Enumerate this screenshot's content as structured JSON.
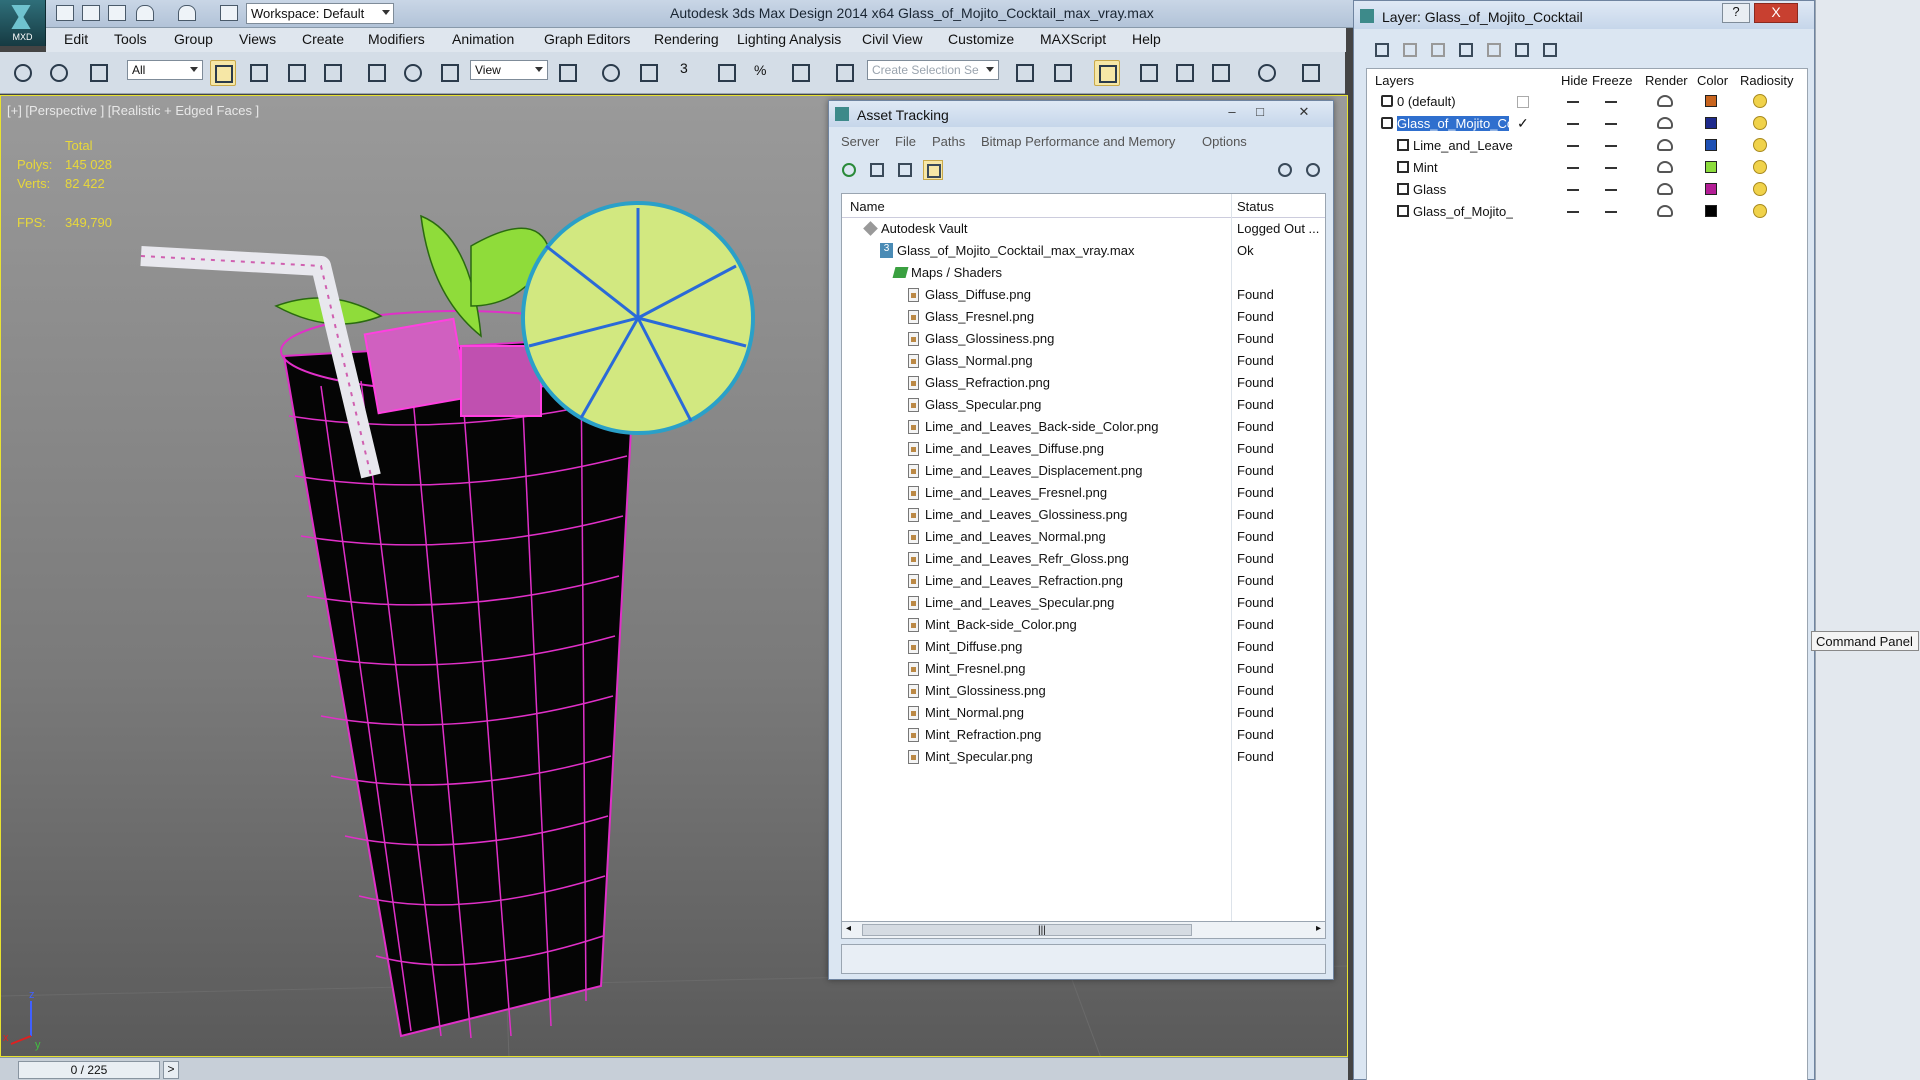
{
  "app": {
    "logo_label": "MXD",
    "title": "Autodesk 3ds Max Design 2014 x64    Glass_of_Mojito_Cocktail_max_vray.max",
    "workspace": "Workspace: Default"
  },
  "menu": [
    "Edit",
    "Tools",
    "Group",
    "Views",
    "Create",
    "Modifiers",
    "Animation",
    "Graph Editors",
    "Rendering",
    "Lighting Analysis",
    "Civil View",
    "Customize",
    "MAXScript",
    "Help"
  ],
  "toolbar": {
    "filter_value": "All",
    "ref_coord_value": "View",
    "selection_set_placeholder": "Create Selection Se",
    "snap_3_label": "3",
    "snap_percent_label": "%"
  },
  "viewport": {
    "label": "[+] [Perspective ] [Realistic + Edged Faces ]",
    "stats": {
      "total_label": "Total",
      "polys_label": "Polys:",
      "polys_value": "145 028",
      "verts_label": "Verts:",
      "verts_value": "82 422",
      "fps_label": "FPS:",
      "fps_value": "349,790"
    },
    "axis_z": "z",
    "axis_y": "y",
    "axis_x": "x"
  },
  "timeline": {
    "frame": "0 / 225",
    "next": ">"
  },
  "asset_tracking": {
    "title": "Asset Tracking",
    "menu": [
      "Server",
      "File",
      "Paths",
      "Bitmap Performance and Memory",
      "Options"
    ],
    "columns": {
      "name": "Name",
      "status": "Status"
    },
    "rows": [
      {
        "name": "Autodesk Vault",
        "status": "Logged Out ...",
        "kind": "vault",
        "indent": 0
      },
      {
        "name": "Glass_of_Mojito_Cocktail_max_vray.max",
        "status": "Ok",
        "kind": "max",
        "indent": 1
      },
      {
        "name": "Maps / Shaders",
        "status": "",
        "kind": "maps",
        "indent": 2
      },
      {
        "name": "Glass_Diffuse.png",
        "status": "Found",
        "kind": "file",
        "indent": 3
      },
      {
        "name": "Glass_Fresnel.png",
        "status": "Found",
        "kind": "file",
        "indent": 3
      },
      {
        "name": "Glass_Glossiness.png",
        "status": "Found",
        "kind": "file",
        "indent": 3
      },
      {
        "name": "Glass_Normal.png",
        "status": "Found",
        "kind": "file",
        "indent": 3
      },
      {
        "name": "Glass_Refraction.png",
        "status": "Found",
        "kind": "file",
        "indent": 3
      },
      {
        "name": "Glass_Specular.png",
        "status": "Found",
        "kind": "file",
        "indent": 3
      },
      {
        "name": "Lime_and_Leaves_Back-side_Color.png",
        "status": "Found",
        "kind": "file",
        "indent": 3
      },
      {
        "name": "Lime_and_Leaves_Diffuse.png",
        "status": "Found",
        "kind": "file",
        "indent": 3
      },
      {
        "name": "Lime_and_Leaves_Displacement.png",
        "status": "Found",
        "kind": "file",
        "indent": 3
      },
      {
        "name": "Lime_and_Leaves_Fresnel.png",
        "status": "Found",
        "kind": "file",
        "indent": 3
      },
      {
        "name": "Lime_and_Leaves_Glossiness.png",
        "status": "Found",
        "kind": "file",
        "indent": 3
      },
      {
        "name": "Lime_and_Leaves_Normal.png",
        "status": "Found",
        "kind": "file",
        "indent": 3
      },
      {
        "name": "Lime_and_Leaves_Refr_Gloss.png",
        "status": "Found",
        "kind": "file",
        "indent": 3
      },
      {
        "name": "Lime_and_Leaves_Refraction.png",
        "status": "Found",
        "kind": "file",
        "indent": 3
      },
      {
        "name": "Lime_and_Leaves_Specular.png",
        "status": "Found",
        "kind": "file",
        "indent": 3
      },
      {
        "name": "Mint_Back-side_Color.png",
        "status": "Found",
        "kind": "file",
        "indent": 3
      },
      {
        "name": "Mint_Diffuse.png",
        "status": "Found",
        "kind": "file",
        "indent": 3
      },
      {
        "name": "Mint_Fresnel.png",
        "status": "Found",
        "kind": "file",
        "indent": 3
      },
      {
        "name": "Mint_Glossiness.png",
        "status": "Found",
        "kind": "file",
        "indent": 3
      },
      {
        "name": "Mint_Normal.png",
        "status": "Found",
        "kind": "file",
        "indent": 3
      },
      {
        "name": "Mint_Refraction.png",
        "status": "Found",
        "kind": "file",
        "indent": 3
      },
      {
        "name": "Mint_Specular.png",
        "status": "Found",
        "kind": "file",
        "indent": 3
      }
    ]
  },
  "layer_dialog": {
    "title": "Layer: Glass_of_Mojito_Cocktail",
    "help": "?",
    "close": "X",
    "columns": {
      "layers": "Layers",
      "hide": "Hide",
      "freeze": "Freeze",
      "render": "Render",
      "color": "Color",
      "radiosity": "Radiosity"
    },
    "rows": [
      {
        "name": "0 (default)",
        "kind": "layer",
        "color": "#c8641e",
        "selected": false,
        "current": false
      },
      {
        "name": "Glass_of_Mojito_Co",
        "kind": "layer",
        "color": "#1e2a8c",
        "selected": true,
        "current": true
      },
      {
        "name": "Lime_and_Leave",
        "kind": "object",
        "color": "#1e50b4",
        "selected": false,
        "current": false
      },
      {
        "name": "Mint",
        "kind": "object",
        "color": "#8cdc3c",
        "selected": false,
        "current": false
      },
      {
        "name": "Glass",
        "kind": "object",
        "color": "#b41e96",
        "selected": false,
        "current": false
      },
      {
        "name": "Glass_of_Mojito_",
        "kind": "object",
        "color": "#000000",
        "selected": false,
        "current": false
      }
    ],
    "current_mark": "✓"
  },
  "command_panel_tooltip": "Command Panel"
}
